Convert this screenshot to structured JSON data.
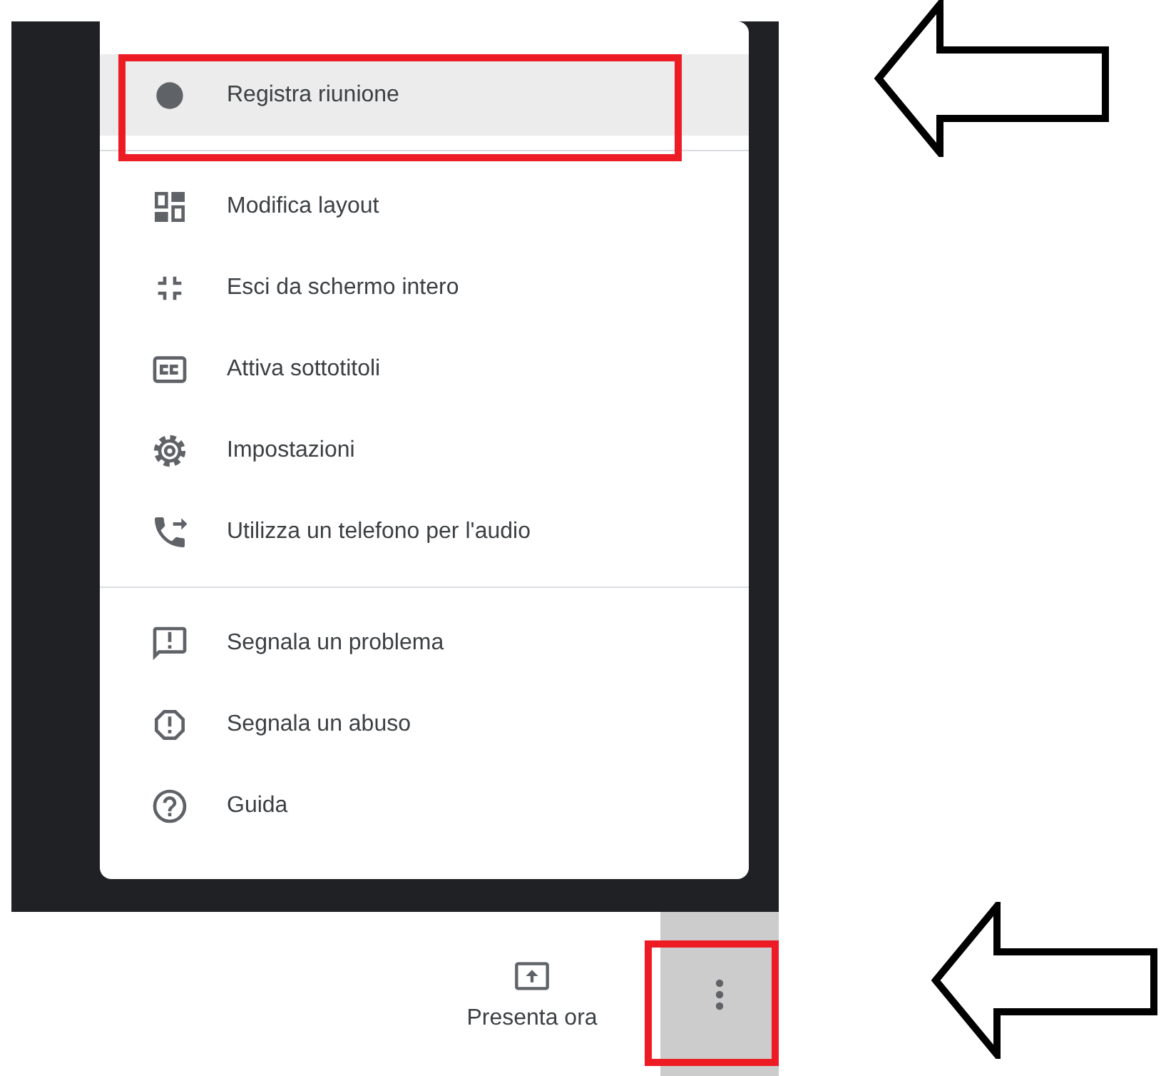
{
  "menu": {
    "sections": [
      {
        "items": [
          {
            "kind": "record",
            "label": "Registra riunione",
            "selected": true,
            "marked": true
          }
        ]
      },
      {
        "items": [
          {
            "kind": "layout",
            "label": "Modifica layout",
            "selected": false,
            "marked": false
          },
          {
            "kind": "exit_fullscreen",
            "label": "Esci da schermo intero",
            "selected": false,
            "marked": false
          },
          {
            "kind": "captions",
            "label": "Attiva sottotitoli",
            "selected": false,
            "marked": false
          },
          {
            "kind": "settings",
            "label": "Impostazioni",
            "selected": false,
            "marked": false
          },
          {
            "kind": "phone",
            "label": "Utilizza un telefono per l'audio",
            "selected": false,
            "marked": false
          }
        ]
      },
      {
        "items": [
          {
            "kind": "feedback",
            "label": "Segnala un problema",
            "selected": false,
            "marked": false
          },
          {
            "kind": "report",
            "label": "Segnala un abuso",
            "selected": false,
            "marked": false
          },
          {
            "kind": "help",
            "label": "Guida",
            "selected": false,
            "marked": false
          }
        ]
      }
    ]
  },
  "toolbar": {
    "present_button": {
      "label": "Presenta ora"
    },
    "more_button": {
      "selected": true,
      "marked": true
    }
  }
}
